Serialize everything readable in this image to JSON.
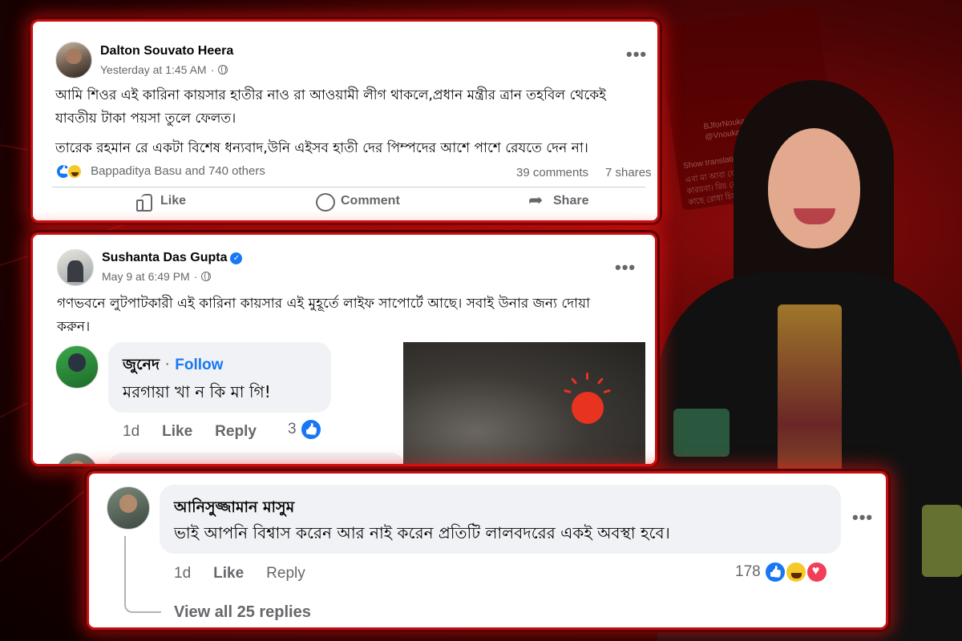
{
  "background_tweet": {
    "handle_name": "BJforNouka",
    "handle": "@Vnouka",
    "show_translation": "Show translation",
    "text_lines": [
      "এবা মা আবা ফেরানিন",
      "কারয়বা। রিয় বেনামিজাব",
      "কাছে রোধা চিরে"
    ]
  },
  "post1": {
    "author": "Dalton Souvato Heera",
    "time": "Yesterday at 1:45 AM",
    "menu": "•••",
    "text_line1": "আমি শিওর এই কারিনা কায়সার হাতীর নাও রা আওয়ামী লীগ থাকলে,প্রধান মন্ত্রীর ত্রান তহবিল থেকেই",
    "text_line2": "যাবতীয় টাকা পয়সা তুলে ফেলত।",
    "text_line3": "তারেক রহমান রে একটা বিশেষ ধন্যবাদ,উনি এইসব হাতী দের পিম্পদের আশে পাশে রেযতে দেন না।",
    "reactions_text": "Bappaditya Basu and 740 others",
    "comments": "39 comments",
    "shares": "7 shares",
    "like_label": "Like",
    "comment_label": "Comment",
    "share_label": "Share"
  },
  "post2": {
    "author": "Sushanta Das Gupta",
    "verified_mark": "✓",
    "time": "May 9 at 6:49 PM",
    "menu": "•••",
    "text_line1": "গণভবনে লুটপাটকারী এই কারিনা কায়সার এই মুহূর্তে লাইফ সাপোর্টে আছে। সবাই উনার জন্য দোয়া",
    "text_line2": "করুন।",
    "comment": {
      "author": "জুনেদ",
      "separator": "·",
      "follow_label": "Follow",
      "text": "মরগায়া খা ন কি মা গি!",
      "age": "1d",
      "like_label": "Like",
      "reply_label": "Reply",
      "reaction_count": "3"
    }
  },
  "post3": {
    "author": "আনিসুজ্জামান মাসুম",
    "text": "ভাই আপনি বিশ্বাস করেন আর নাই করেন প্রতিটি লালবদরের একই অবস্থা হবে।",
    "menu": "•••",
    "age": "1d",
    "like_label": "Like",
    "reply_label": "Reply",
    "reaction_count": "178",
    "view_replies": "View all 25 replies"
  },
  "colors": {
    "accent_blue": "#1877f2",
    "frame_red": "#c41010",
    "meta_gray": "#65676b"
  }
}
